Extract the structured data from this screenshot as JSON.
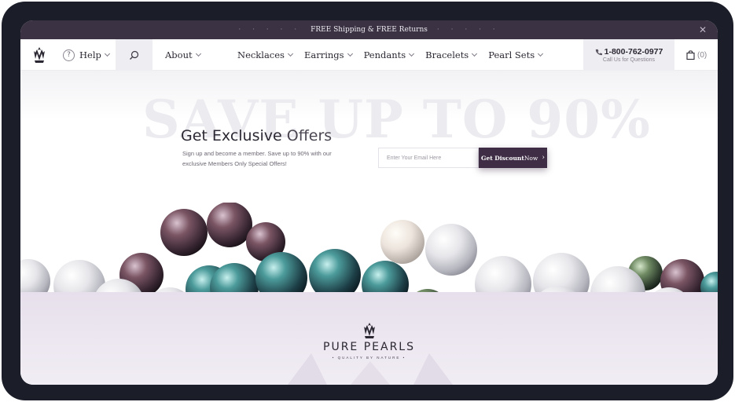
{
  "announcement": {
    "text": "FREE Shipping & FREE Returns",
    "close_icon": "close-icon"
  },
  "nav": {
    "logo_icon": "pearl-crown-logo-icon",
    "help_label": "Help",
    "help_icon": "question-circle-icon",
    "search_icon": "search-icon",
    "about_label": "About",
    "menu": [
      {
        "label": "Necklaces"
      },
      {
        "label": "Earrings"
      },
      {
        "label": "Pendants"
      },
      {
        "label": "Bracelets"
      },
      {
        "label": "Pearl Sets"
      }
    ],
    "phone_number": "1-800-762-0977",
    "phone_sub": "Call Us for Questions",
    "phone_icon": "phone-icon",
    "cart_count": "(0)",
    "cart_icon": "shopping-bag-icon"
  },
  "hero": {
    "background_text": "SAVE UP TO 90%",
    "title_main": "Get Exclusive",
    "title_light": " Offers",
    "description": "Sign up and become a member. Save up to 90% with our exclusive Members Only Special Offers!",
    "email_placeholder": "Enter Your Email Here",
    "cta_main": "Get Discount",
    "cta_light": " Now",
    "cta_arrow": "›"
  },
  "brand": {
    "name": "PURE PEARLS",
    "tagline": "• QUALITY BY NATURE •"
  },
  "colors": {
    "topbar": "#3b3243",
    "accent": "#3f2d45",
    "band": "#e7e0ec",
    "frame": "#1b1e29"
  }
}
